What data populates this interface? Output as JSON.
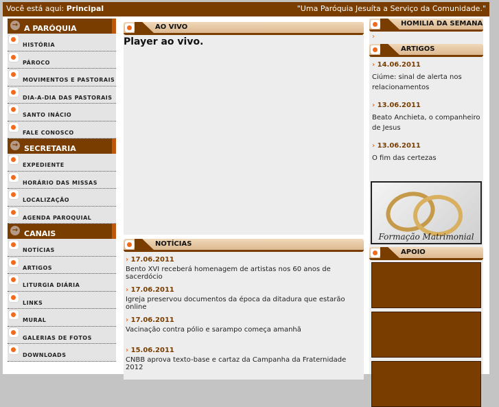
{
  "topbar": {
    "prefix": "Você está aqui:",
    "current": "Principal",
    "motto": "\"Uma Paróquia Jesuíta a Serviço da Comunidade.\""
  },
  "sidebar": [
    {
      "title": "A PARÓQUIA",
      "items": [
        "HISTÓRIA",
        "PÁROCO",
        "MOVIMENTOS E PASTORAIS",
        "DIA-A-DIA DAS PASTORAIS",
        "SANTO INÁCIO",
        "FALE CONOSCO"
      ]
    },
    {
      "title": "SECRETARIA",
      "items": [
        "EXPEDIENTE",
        "HORÁRIO DAS MISSAS",
        "LOCALIZAÇÃO",
        "AGENDA PAROQUIAL"
      ]
    },
    {
      "title": "CANAIS",
      "items": [
        "NOTÍCIAS",
        "ARTIGOS",
        "LITURGIA DIÁRIA",
        "LINKS",
        "MURAL",
        "GALERIAS DE FOTOS",
        "DOWNLOADS"
      ]
    }
  ],
  "live": {
    "title": "AO VIVO",
    "text": "Player ao vivo."
  },
  "news": {
    "title": "NOTÍCIAS",
    "items": [
      {
        "date": "17.06.2011",
        "text": "Bento XVI receberá homenagem de artistas nos 60 anos de sacerdócio"
      },
      {
        "date": "17.06.2011",
        "text": "Igreja preservou documentos da época da ditadura que estarão online"
      },
      {
        "date": "17.06.2011",
        "text": "Vacinação contra pólio e sarampo começa amanhã"
      },
      {
        "date": "15.06.2011",
        "text": "CNBB aprova texto-base e cartaz da Campanha da Fraternidade 2012"
      }
    ]
  },
  "right": {
    "homily_title": "HOMILIA DA SEMANA",
    "articles_title": "ARTIGOS",
    "articles": [
      {
        "date": "14.06.2011",
        "text": "Ciúme: sinal de alerta nos relacionamentos"
      },
      {
        "date": "13.06.2011",
        "text": "Beato Anchieta, o companheiro de Jesus"
      },
      {
        "date": "13.06.2011",
        "text": "O fim das certezas"
      }
    ],
    "banner": "Formação Matrimonial",
    "support_title": "APOIO"
  }
}
